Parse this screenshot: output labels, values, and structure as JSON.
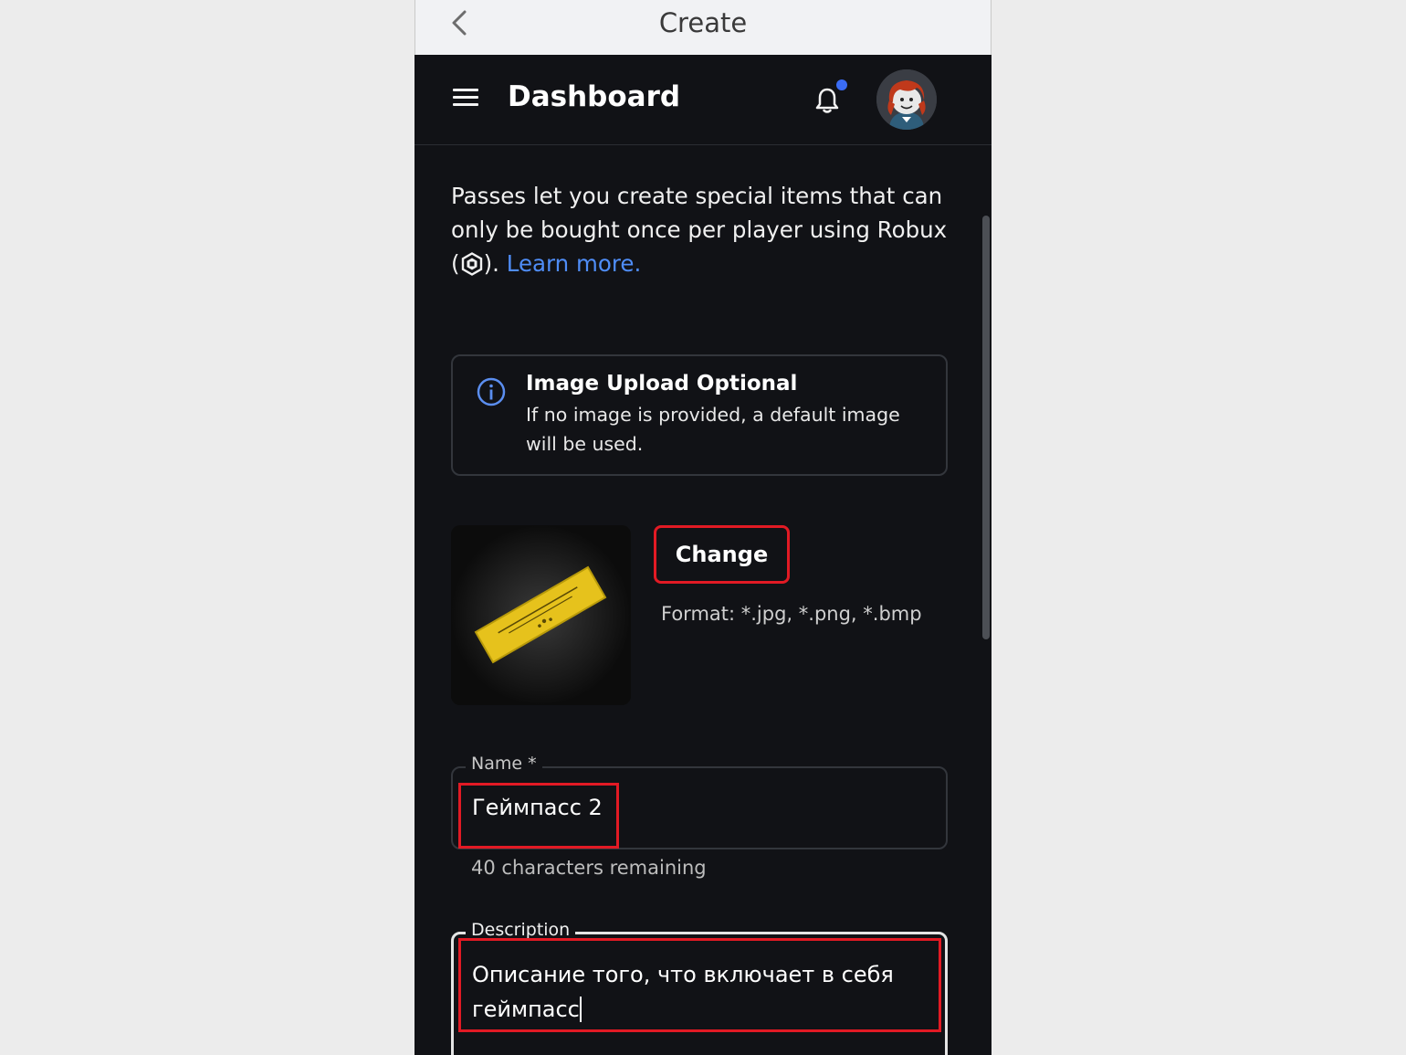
{
  "topbar": {
    "title": "Create"
  },
  "header": {
    "title": "Dashboard"
  },
  "intro": {
    "text_before": "Passes let you create special items that can only be bought once per player using Robux (",
    "text_after": ").",
    "link": "Learn more."
  },
  "info_box": {
    "title": "Image Upload Optional",
    "text": "If no image is provided, a default image will be used."
  },
  "image_section": {
    "change_label": "Change",
    "format_text": "Format: *.jpg, *.png, *.bmp"
  },
  "name_field": {
    "label": "Name *",
    "value": "Геймпасс 2",
    "remaining": "40 characters remaining"
  },
  "description_field": {
    "label": "Description",
    "value": "Описание того, что включает в себя геймпасс"
  },
  "colors": {
    "accent_link": "#4f8df7",
    "highlight_red": "#e21a24",
    "notification_dot": "#3a6cf5",
    "background": "#111216"
  },
  "icons": [
    "back-chevron-icon",
    "menu-icon",
    "bell-icon",
    "robux-icon",
    "info-icon"
  ]
}
